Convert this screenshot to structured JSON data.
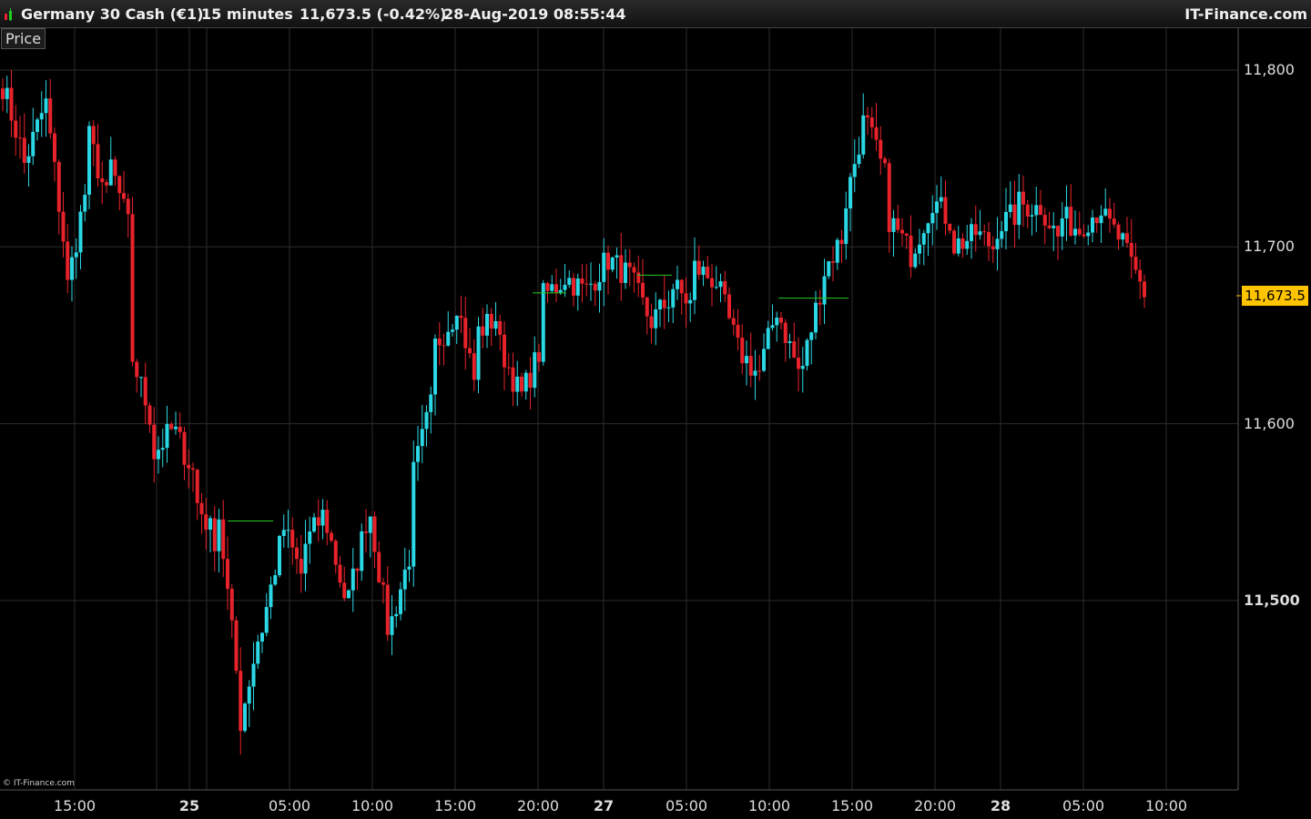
{
  "header": {
    "instrument": "Germany 30 Cash (€1)",
    "timeframe": "15 minutes",
    "last_change": "11,673.5 (-0.42%)",
    "datetime": "28-Aug-2019 08:55:44",
    "brand": "IT-Finance.com",
    "icon": "candlestick-chart-icon"
  },
  "panel_label": "Price",
  "copyright": "© IT-Finance.com",
  "last_price_label": "11,673.5",
  "colors": {
    "up": "#2ad7e4",
    "down": "#e8222a",
    "grid": "#2c2c2c",
    "highlight": "#ffc400",
    "level": "#22cc22"
  },
  "chart_data": {
    "type": "candlestick",
    "y_ticks": [
      "11,800",
      "11,700",
      "11,600",
      "11,500"
    ],
    "x_ticks": [
      "15:00",
      "25",
      "05:00",
      "10:00",
      "15:00",
      "20:00",
      "27",
      "05:00",
      "10:00",
      "15:00",
      "20:00",
      "28",
      "05:00",
      "10:00"
    ],
    "ylim": [
      11410,
      11860
    ],
    "last": 11673.5,
    "grid": true,
    "path": [
      [
        11800,
        11758
      ],
      [
        11740,
        11775
      ],
      [
        11800,
        11705
      ],
      [
        11665,
        11730
      ],
      [
        11770,
        11728
      ],
      [
        11755,
        11712
      ],
      [
        11645,
        11605
      ],
      [
        11580,
        11596
      ],
      [
        11600,
        11573
      ],
      [
        11560,
        11535
      ],
      [
        11570,
        11460
      ],
      [
        11420,
        11478
      ],
      [
        11473,
        11530
      ],
      [
        11547,
        11515
      ],
      [
        11528,
        11548
      ],
      [
        11552,
        11503
      ],
      [
        11490,
        11545
      ],
      [
        11565,
        11485
      ],
      [
        11480,
        11525
      ],
      [
        11562,
        11610
      ],
      [
        11640,
        11660
      ],
      [
        11680,
        11625
      ],
      [
        11650,
        11660
      ],
      [
        11650,
        11620
      ],
      [
        11610,
        11640
      ],
      [
        11670,
        11680
      ],
      [
        11685,
        11676
      ],
      [
        11672,
        11690
      ],
      [
        11695,
        11685
      ],
      [
        11688,
        11662
      ],
      [
        11655,
        11670
      ],
      [
        11680,
        11668
      ],
      [
        11690,
        11682
      ],
      [
        11688,
        11650
      ],
      [
        11645,
        11630
      ],
      [
        11620,
        11665
      ],
      [
        11665,
        11630
      ],
      [
        11622,
        11675
      ],
      [
        11682,
        11705
      ],
      [
        11715,
        11770
      ],
      [
        11775,
        11740
      ],
      [
        11720,
        11700
      ],
      [
        11690,
        11720
      ],
      [
        11730,
        11715
      ],
      [
        11700,
        11705
      ],
      [
        11710,
        11700
      ],
      [
        11710,
        11718
      ],
      [
        11725,
        11722
      ],
      [
        11728,
        11705
      ],
      [
        11718,
        11710
      ],
      [
        11712,
        11722
      ],
      [
        11718,
        11702
      ],
      [
        11700,
        11674
      ]
    ]
  }
}
